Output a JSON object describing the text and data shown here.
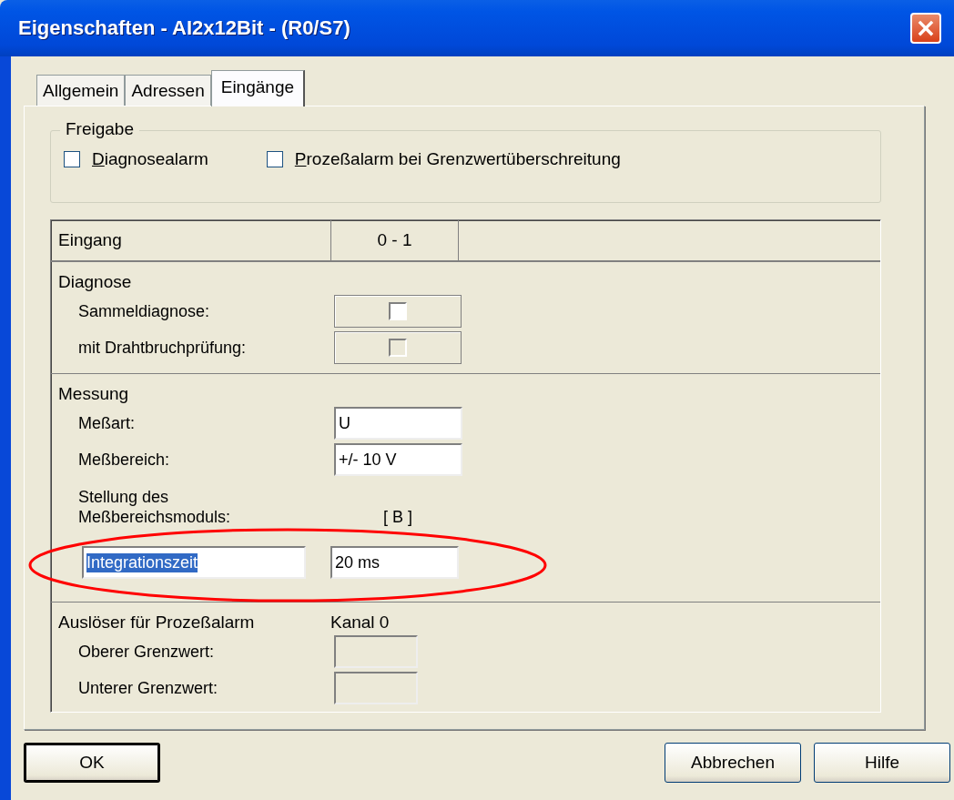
{
  "window": {
    "title": "Eigenschaften - AI2x12Bit - (R0/S7)",
    "close": "×"
  },
  "tabs": [
    {
      "label": "Allgemein",
      "selected": false
    },
    {
      "label": "Adressen",
      "selected": false
    },
    {
      "label": "Eingänge",
      "selected": true
    }
  ],
  "release": {
    "title": "Freigabe",
    "checkboxes": [
      {
        "label": "Diagnosealarm",
        "checked": false
      },
      {
        "label": "Prozeßalarm bei Grenzwertüberschreitung",
        "checked": false
      }
    ]
  },
  "table": {
    "columns": [
      "Eingang",
      "0 - 1"
    ],
    "sections": [
      {
        "title": "Diagnose",
        "rows": [
          {
            "kind": "checkbox",
            "label": "Sammeldiagnose:",
            "checked": false,
            "disabled": false
          },
          {
            "kind": "checkbox",
            "label": "mit Drahtbruchprüfung:",
            "checked": false,
            "disabled": true
          }
        ]
      },
      {
        "title": "Messung",
        "rows": [
          {
            "kind": "field",
            "label": "Meßart:",
            "value": "U",
            "disabled": false
          },
          {
            "kind": "field",
            "label": "Meßbereich:",
            "value": "+/- 10 V",
            "disabled": false
          },
          {
            "kind": "text",
            "label": "Stellung des\nMeßbereichsmoduls:",
            "value": "[ B ]"
          },
          {
            "kind": "editable",
            "label": "Integrationszeit",
            "value": "20 ms",
            "selected": true,
            "highlighted": true
          }
        ]
      },
      {
        "title": "Auslöser für Prozeßalarm",
        "value": "Kanal 0",
        "rows": [
          {
            "kind": "small-field",
            "label": "Oberer Grenzwert:",
            "disabled": true
          },
          {
            "kind": "small-field",
            "label": "Unterer Grenzwert:",
            "disabled": true
          }
        ]
      }
    ]
  },
  "buttons": [
    {
      "label": "OK",
      "default": true
    },
    {
      "label": "Abbrechen",
      "default": false
    },
    {
      "label": "Hilfe",
      "default": false
    }
  ]
}
